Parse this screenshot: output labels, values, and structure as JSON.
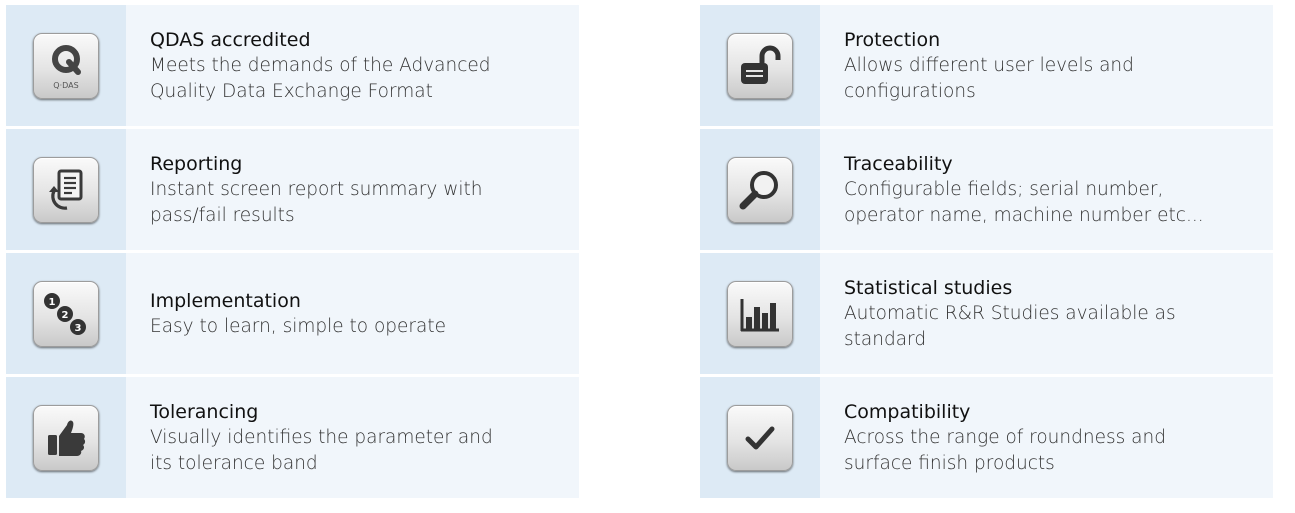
{
  "left": [
    {
      "icon": "qdas-logo-icon",
      "title": "QDAS accredited",
      "line1": "Meets the demands of the Advanced",
      "line2": "Quality Data Exchange Format",
      "logo_text": "Q·DAS"
    },
    {
      "icon": "report-refresh-icon",
      "title": "Reporting",
      "line1": "Instant screen report summary with",
      "line2": "pass/fail results"
    },
    {
      "icon": "numbered-steps-icon",
      "title": "Implementation",
      "line1": "Easy to learn, simple to operate",
      "line2": ""
    },
    {
      "icon": "thumbs-up-icon",
      "title": "Tolerancing",
      "line1": "Visually identifies the parameter and",
      "line2": "its tolerance band"
    }
  ],
  "right": [
    {
      "icon": "unlocked-padlock-icon",
      "title": "Protection",
      "line1": "Allows different user levels and",
      "line2": "configurations"
    },
    {
      "icon": "magnifier-icon",
      "title": "Traceability",
      "line1": "Configurable fields; serial number,",
      "line2": "operator name, machine number etc..."
    },
    {
      "icon": "bar-chart-icon",
      "title": "Statistical studies",
      "line1": "Automatic R&R Studies available as",
      "line2": "standard"
    },
    {
      "icon": "checkmark-icon",
      "title": "Compatibility",
      "line1": "Across the range of roundness and",
      "line2": "surface finish products"
    }
  ],
  "colors": {
    "icon_panel": "#ddeaf5",
    "text_panel": "#f1f6fb",
    "icon_glyph": "#3a3a3a"
  }
}
